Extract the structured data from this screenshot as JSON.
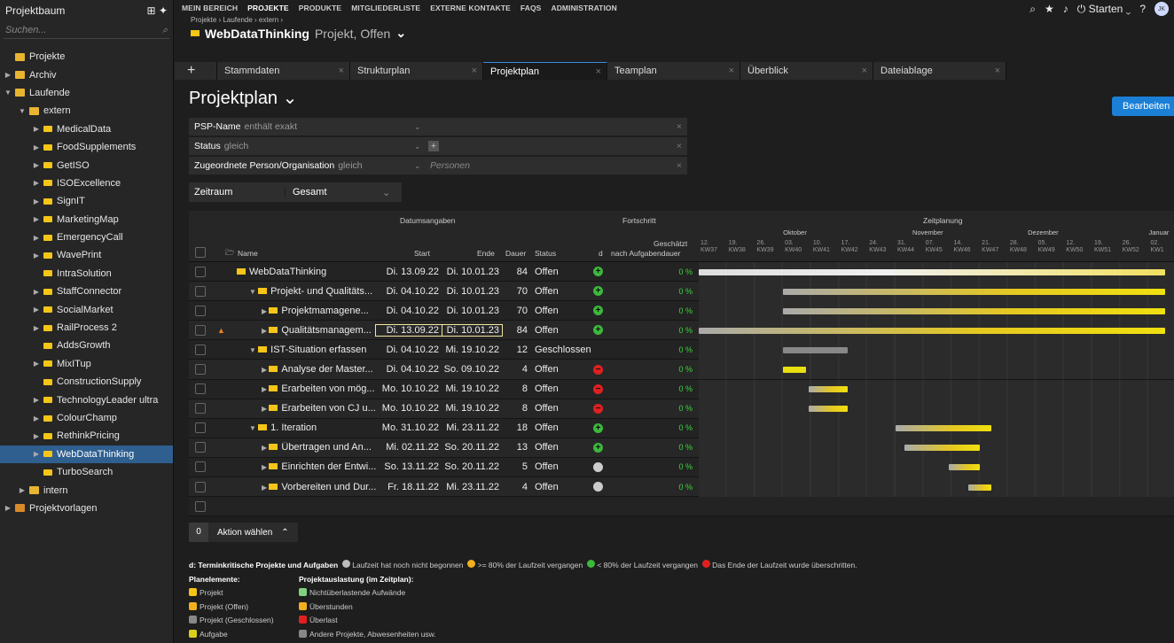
{
  "sidebar": {
    "title": "Projektbaum",
    "search_placeholder": "Suchen...",
    "items": [
      {
        "label": "Projekte",
        "level": 0,
        "kind": "root"
      },
      {
        "label": "Archiv",
        "level": 0,
        "kind": "folder",
        "arrow": "▶"
      },
      {
        "label": "Laufende",
        "level": 0,
        "kind": "folder",
        "arrow": "▼"
      },
      {
        "label": "extern",
        "level": 1,
        "kind": "folder",
        "arrow": "▼"
      },
      {
        "label": "MedicalData",
        "level": 2,
        "kind": "proj",
        "arrow": "▶"
      },
      {
        "label": "FoodSupplements",
        "level": 2,
        "kind": "proj",
        "arrow": "▶"
      },
      {
        "label": "GetISO",
        "level": 2,
        "kind": "proj",
        "arrow": "▶"
      },
      {
        "label": "ISOExcellence",
        "level": 2,
        "kind": "proj",
        "arrow": "▶"
      },
      {
        "label": "SignIT",
        "level": 2,
        "kind": "proj",
        "arrow": "▶"
      },
      {
        "label": "MarketingMap",
        "level": 2,
        "kind": "proj",
        "arrow": "▶"
      },
      {
        "label": "EmergencyCall",
        "level": 2,
        "kind": "proj",
        "arrow": "▶"
      },
      {
        "label": "WavePrint",
        "level": 2,
        "kind": "proj",
        "arrow": "▶"
      },
      {
        "label": "IntraSolution",
        "level": 2,
        "kind": "proj",
        "arrow": ""
      },
      {
        "label": "StaffConnector",
        "level": 2,
        "kind": "proj",
        "arrow": "▶"
      },
      {
        "label": "SocialMarket",
        "level": 2,
        "kind": "proj",
        "arrow": "▶"
      },
      {
        "label": "RailProcess 2",
        "level": 2,
        "kind": "proj",
        "arrow": "▶"
      },
      {
        "label": "AddsGrowth",
        "level": 2,
        "kind": "proj",
        "arrow": ""
      },
      {
        "label": "MixITup",
        "level": 2,
        "kind": "proj",
        "arrow": "▶"
      },
      {
        "label": "ConstructionSupply",
        "level": 2,
        "kind": "proj",
        "arrow": ""
      },
      {
        "label": "TechnologyLeader ultra",
        "level": 2,
        "kind": "proj",
        "arrow": "▶"
      },
      {
        "label": "ColourChamp",
        "level": 2,
        "kind": "proj",
        "arrow": "▶"
      },
      {
        "label": "RethinkPricing",
        "level": 2,
        "kind": "proj",
        "arrow": "▶"
      },
      {
        "label": "WebDataThinking",
        "level": 2,
        "kind": "proj",
        "arrow": "▶",
        "selected": true
      },
      {
        "label": "TurboSearch",
        "level": 2,
        "kind": "proj",
        "arrow": ""
      },
      {
        "label": "intern",
        "level": 1,
        "kind": "folder",
        "arrow": "▶"
      },
      {
        "label": "Projektvorlagen",
        "level": 0,
        "kind": "tmpl",
        "arrow": "▶"
      }
    ]
  },
  "topnav": {
    "items": [
      "MEIN BEREICH",
      "PROJEKTE",
      "PRODUKTE",
      "MITGLIEDERLISTE",
      "EXTERNE KONTAKTE",
      "FAQS",
      "ADMINISTRATION"
    ],
    "starten": "Starten",
    "avatar": "JK"
  },
  "breadcrumb": "Projekte › Laufende › extern ›",
  "project": {
    "name": "WebDataThinking",
    "sub": "Projekt, Offen"
  },
  "tabs": [
    "Stammdaten",
    "Strukturplan",
    "Projektplan",
    "Teamplan",
    "Überblick",
    "Dateiablage"
  ],
  "page": {
    "title": "Projektplan",
    "edit": "Bearbeiten"
  },
  "filters": [
    {
      "field": "PSP-Name",
      "op": "enthält exakt",
      "placeholder": ""
    },
    {
      "field": "Status",
      "op": "gleich",
      "placeholder": ""
    },
    {
      "field": "Zugeordnete Person/Organisation",
      "op": "gleich",
      "placeholder": "Personen"
    }
  ],
  "zeitraum": {
    "label": "Zeitraum",
    "value": "Gesamt"
  },
  "columns": {
    "group_dates": "Datumsangaben",
    "group_progress": "Fortschritt",
    "group_plan": "Zeitplanung",
    "name": "Name",
    "start": "Start",
    "end": "Ende",
    "dauer": "Dauer",
    "status": "Status",
    "d": "d",
    "est1": "Geschätzt",
    "est2": "nach Aufgabendauer"
  },
  "months": [
    "Oktober",
    "November",
    "Dezember",
    "Januar"
  ],
  "weeks": [
    {
      "d": "12.",
      "kw": "KW37"
    },
    {
      "d": "19.",
      "kw": "KW38"
    },
    {
      "d": "26.",
      "kw": "KW39"
    },
    {
      "d": "03.",
      "kw": "KW40"
    },
    {
      "d": "10.",
      "kw": "KW41"
    },
    {
      "d": "17.",
      "kw": "KW42"
    },
    {
      "d": "24.",
      "kw": "KW43"
    },
    {
      "d": "31.",
      "kw": "KW44"
    },
    {
      "d": "07.",
      "kw": "KW45"
    },
    {
      "d": "14.",
      "kw": "KW46"
    },
    {
      "d": "21.",
      "kw": "KW47"
    },
    {
      "d": "28.",
      "kw": "KW48"
    },
    {
      "d": "05.",
      "kw": "KW49"
    },
    {
      "d": "12.",
      "kw": "KW50"
    },
    {
      "d": "19.",
      "kw": "KW51"
    },
    {
      "d": "26.",
      "kw": "KW52"
    },
    {
      "d": "02.",
      "kw": "KW1"
    }
  ],
  "rows": [
    {
      "name": "WebDataThinking",
      "indent": 0,
      "arrow": "",
      "start": "Di. 13.09.22",
      "end": "Di. 10.01.23",
      "dauer": "84",
      "status": "Offen",
      "d": "plus",
      "pct": "0 %",
      "bar": [
        0,
        16.6
      ],
      "color": "silver"
    },
    {
      "name": "Projekt- und Qualitäts...",
      "indent": 1,
      "arrow": "▼",
      "start": "Di. 04.10.22",
      "end": "Di. 10.01.23",
      "dauer": "70",
      "status": "Offen",
      "d": "plus",
      "pct": "0 %",
      "bar": [
        3,
        16.6
      ],
      "color": "gy"
    },
    {
      "name": "Projektmamagene...",
      "indent": 2,
      "arrow": "▶",
      "start": "Di. 04.10.22",
      "end": "Di. 10.01.23",
      "dauer": "70",
      "status": "Offen",
      "d": "plus",
      "pct": "0 %",
      "bar": [
        3,
        16.6
      ],
      "color": "gy"
    },
    {
      "name": "Qualitätsmanagem...",
      "indent": 2,
      "arrow": "▶",
      "start": "Di. 13.09.22",
      "end": "Di. 10.01.23",
      "dauer": "84",
      "status": "Offen",
      "d": "plus",
      "pct": "0 %",
      "bar": [
        0,
        16.6
      ],
      "color": "gy",
      "warn": true,
      "hl": true
    },
    {
      "name": "IST-Situation erfassen",
      "indent": 1,
      "arrow": "▼",
      "start": "Di. 04.10.22",
      "end": "Mi. 19.10.22",
      "dauer": "12",
      "status": "Geschlossen",
      "d": "",
      "pct": "0 %",
      "bar": [
        3,
        5.3
      ],
      "color": "grey"
    },
    {
      "name": "Analyse der Master...",
      "indent": 2,
      "arrow": "▶",
      "start": "Di. 04.10.22",
      "end": "So. 09.10.22",
      "dauer": "4",
      "status": "Offen",
      "d": "minus",
      "pct": "0 %",
      "bar": [
        3,
        3.8
      ],
      "color": "y"
    },
    {
      "name": "Erarbeiten von mög...",
      "indent": 2,
      "arrow": "▶",
      "start": "Mo. 10.10.22",
      "end": "Mi. 19.10.22",
      "dauer": "8",
      "status": "Offen",
      "d": "minus",
      "pct": "0 %",
      "bar": [
        3.9,
        5.3
      ],
      "color": "gy"
    },
    {
      "name": "Erarbeiten von CJ u...",
      "indent": 2,
      "arrow": "▶",
      "start": "Mo. 10.10.22",
      "end": "Mi. 19.10.22",
      "dauer": "8",
      "status": "Offen",
      "d": "minus",
      "pct": "0 %",
      "bar": [
        3.9,
        5.3
      ],
      "color": "gy"
    },
    {
      "name": "1. Iteration",
      "indent": 1,
      "arrow": "▼",
      "start": "Mo. 31.10.22",
      "end": "Mi. 23.11.22",
      "dauer": "18",
      "status": "Offen",
      "d": "plus",
      "pct": "0 %",
      "bar": [
        7,
        10.4
      ],
      "color": "gy"
    },
    {
      "name": "Übertragen und An...",
      "indent": 2,
      "arrow": "▶",
      "start": "Mi. 02.11.22",
      "end": "So. 20.11.22",
      "dauer": "13",
      "status": "Offen",
      "d": "plus",
      "pct": "0 %",
      "bar": [
        7.3,
        10
      ],
      "color": "gy"
    },
    {
      "name": "Einrichten der Entwi...",
      "indent": 2,
      "arrow": "▶",
      "start": "So. 13.11.22",
      "end": "So. 20.11.22",
      "dauer": "5",
      "status": "Offen",
      "d": "grey",
      "pct": "0 %",
      "bar": [
        8.9,
        10
      ],
      "color": "gy"
    },
    {
      "name": "Vorbereiten und Dur...",
      "indent": 2,
      "arrow": "▶",
      "start": "Fr. 18.11.22",
      "end": "Mi. 23.11.22",
      "dauer": "4",
      "status": "Offen",
      "d": "grey",
      "pct": "0 %",
      "bar": [
        9.6,
        10.4
      ],
      "color": "gy"
    }
  ],
  "action": {
    "count": "0",
    "label": "Aktion wählen"
  },
  "legend": {
    "line1": "d: Terminkritische Projekte und Aufgaben",
    "l_grey": "Laufzeit hat noch nicht begonnen",
    "l_orange": ">= 80% der Laufzeit vergangen",
    "l_green": "< 80% der Laufzeit vergangen",
    "l_red": "Das Ende der Laufzeit wurde überschritten.",
    "plan_title": "Planelemente:",
    "load_title": "Projektauslastung (im Zeitplan):",
    "plan": [
      {
        "label": "Projekt",
        "color": "#f5c518"
      },
      {
        "label": "Projekt (Offen)",
        "color": "#f2b01e"
      },
      {
        "label": "Projekt (Geschlossen)",
        "color": "#888888"
      },
      {
        "label": "Aufgabe",
        "color": "#d9d21a"
      }
    ],
    "load": [
      {
        "label": "Nichtüberlastende Aufwände",
        "color": "#7fd17f"
      },
      {
        "label": "Überstunden",
        "color": "#f2b01e"
      },
      {
        "label": "Überlast",
        "color": "#e02020"
      },
      {
        "label": "Andere Projekte, Abwesenheiten usw.",
        "color": "#888888"
      }
    ]
  }
}
